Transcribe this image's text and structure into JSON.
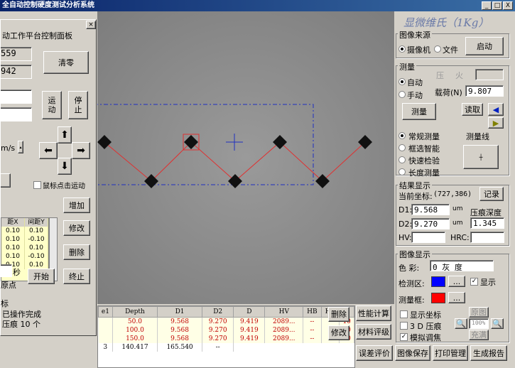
{
  "window": {
    "title": "全自动控制硬度测试分析系统",
    "min": "_",
    "max": "□",
    "close": "X"
  },
  "app_title": "显微维氏（1Kg）",
  "image_source": {
    "group": "图像来源",
    "camera": "摄像机",
    "file": "文件",
    "start": "启动"
  },
  "measure": {
    "group": "测量",
    "auto": "自动",
    "manual": "手动",
    "press_label": "压",
    "fire_label": "火",
    "load_label": "载荷(N)",
    "load_value": "9.807",
    "measure_btn": "测量",
    "read_btn": "读取",
    "modes": [
      "常规测量",
      "框选智能",
      "快速检验",
      "长度测量"
    ],
    "line_label": "测量线"
  },
  "result": {
    "group": "结果显示",
    "coord_label": "当前坐标:",
    "coord_value": "(727,386)",
    "record": "记录",
    "d1_label": "D1:",
    "d1_value": "9.568",
    "d2_label": "D2:",
    "d2_value": "9.270",
    "unit": "um",
    "depth_label": "压痕深度",
    "depth_value": "1.345",
    "hv_label": "HV:",
    "hrc_label": "HRC:"
  },
  "display": {
    "group": "图像显示",
    "color_label": "色  彩:",
    "color_value": "0  灰    度",
    "detect_label": "检测区:",
    "frame_label": "测量框:",
    "show": "显示",
    "dots": "...",
    "show_coord": "显示坐标",
    "three_d": "3 D 压痕",
    "sim": "模拟调焦",
    "orig": "原图",
    "zoom": "100%",
    "fill": "充满",
    "detect_color": "#0000ff",
    "frame_color": "#ff0000"
  },
  "side_buttons": {
    "delete": "删除",
    "modify": "修改",
    "perf": "性能计算",
    "material": "材料评级",
    "error": "误差评价",
    "save_img": "图像保存",
    "print": "打印管理",
    "report": "生成报告"
  },
  "results_table": {
    "headers": [
      "e1",
      "Depth",
      "D1",
      "D2",
      "D",
      "HV",
      "HB",
      "HK",
      "H"
    ],
    "rows": [
      [
        "",
        "50.0",
        "9.568",
        "9.270",
        "9.419",
        "2089...",
        "--",
        "--",
        "10"
      ],
      [
        "",
        "100.0",
        "9.568",
        "9.270",
        "9.419",
        "2089...",
        "--",
        "--",
        "10"
      ],
      [
        "",
        "150.0",
        "9.568",
        "9.270",
        "9.419",
        "2089...",
        "--",
        "--",
        "10"
      ]
    ],
    "partial_row": [
      "3",
      "140.417",
      "165.540",
      "--"
    ]
  },
  "platform": {
    "title": "动工作平台控制面板",
    "x_value": "559",
    "y_value": "942",
    "clear": "清零",
    "move": "运\n动",
    "stop": "停\n止",
    "speed_unit": "m/s",
    "mouse_move": "鼠标点击运动",
    "table_headers": [
      "距X",
      "间距Y"
    ],
    "table_rows": [
      [
        "0.10",
        "0.10"
      ],
      [
        "0.10",
        "-0.10"
      ],
      [
        "0.10",
        "0.10"
      ],
      [
        "0.10",
        "-0.10"
      ],
      [
        "0.10",
        "0.10"
      ]
    ],
    "add": "增加",
    "modify": "修改",
    "delete": "删除",
    "sec": "秒",
    "start": "开始",
    "end": "终止",
    "origin": "原点",
    "status_label": "标",
    "status1": "已操作完成",
    "status2": "压痕 10 个"
  }
}
